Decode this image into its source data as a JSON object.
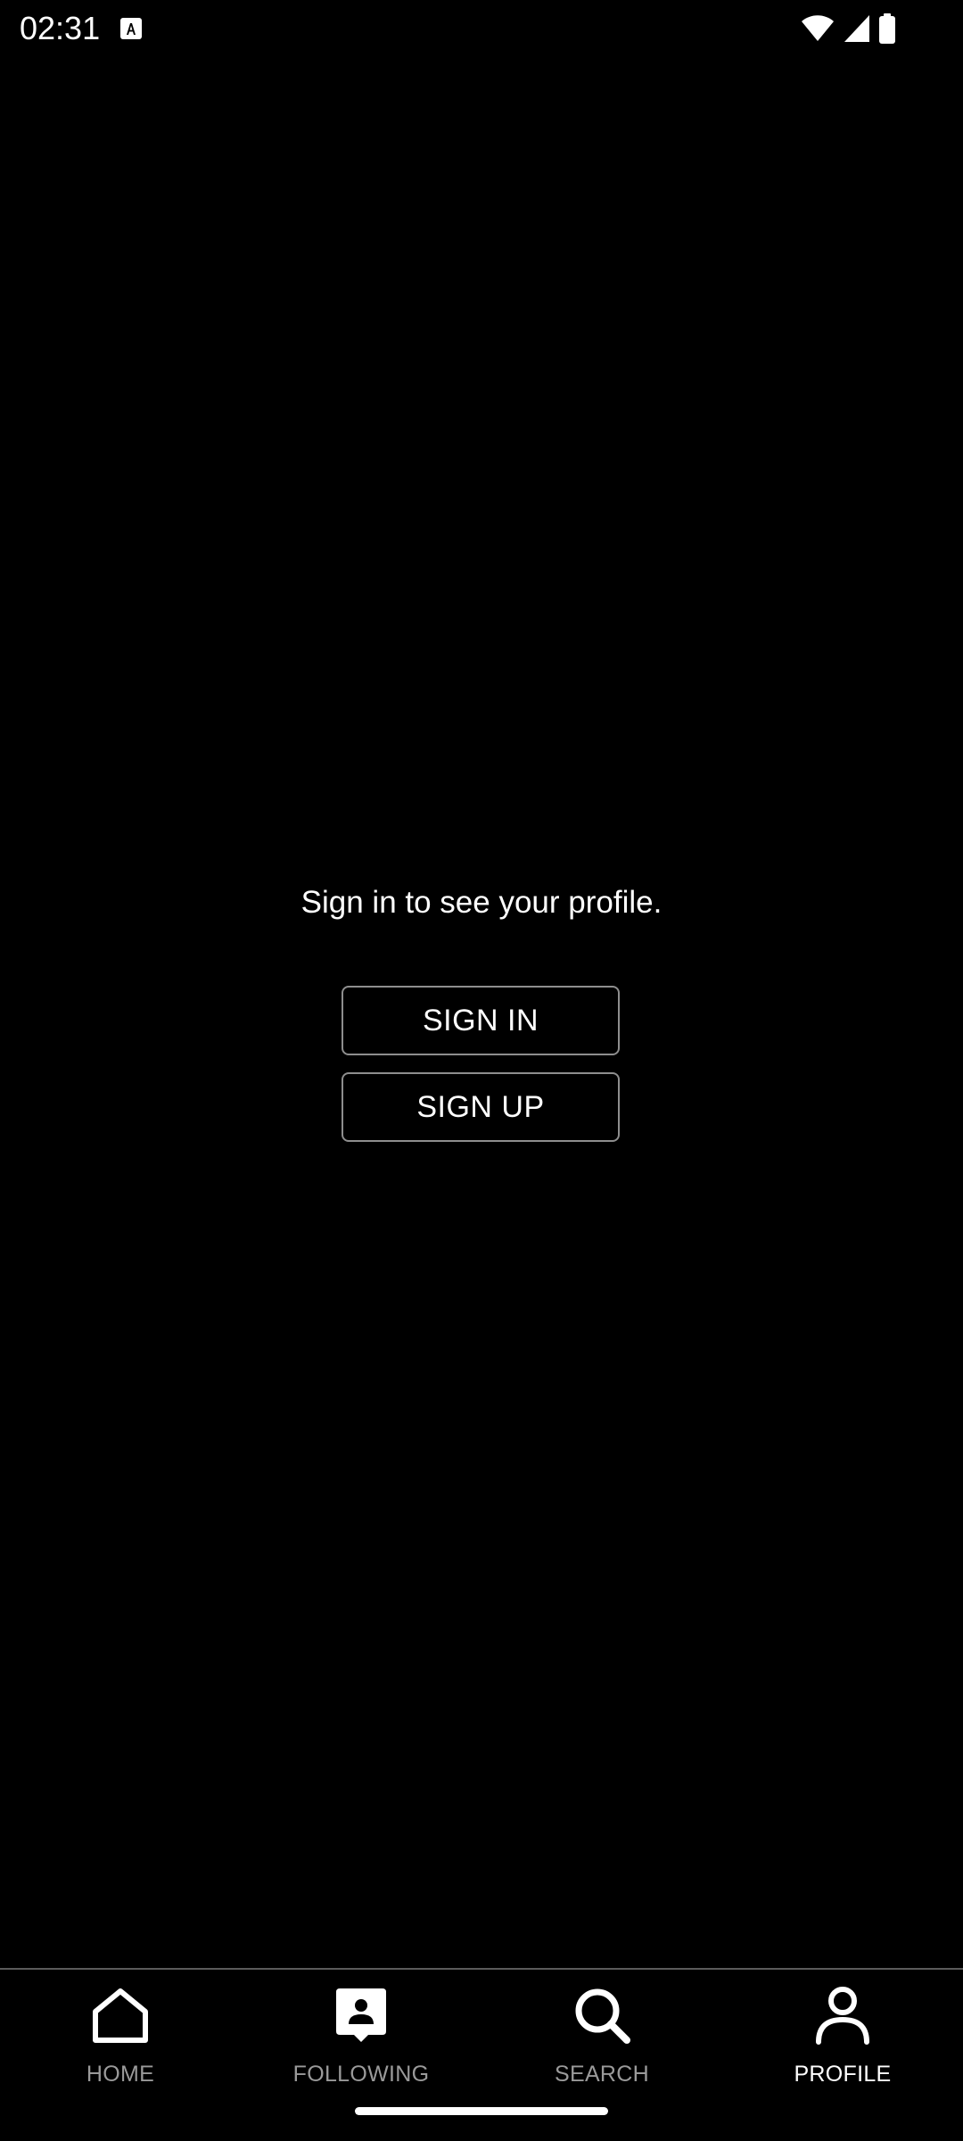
{
  "status_bar": {
    "time": "02:31",
    "icons": [
      "a-notification-icon",
      "wifi-icon",
      "signal-icon",
      "battery-icon"
    ]
  },
  "main": {
    "prompt": "Sign in to see your profile.",
    "sign_in_label": "SIGN IN",
    "sign_up_label": "SIGN UP"
  },
  "bottom_nav": {
    "items": [
      {
        "label": "HOME",
        "icon": "home-icon",
        "active": false
      },
      {
        "label": "FOLLOWING",
        "icon": "following-icon",
        "active": false
      },
      {
        "label": "SEARCH",
        "icon": "search-icon",
        "active": false
      },
      {
        "label": "PROFILE",
        "icon": "profile-icon",
        "active": true
      }
    ]
  },
  "colors": {
    "background": "#000000",
    "text": "#ffffff",
    "inactive_label": "#9a9a9a",
    "button_border": "#8e8e8e"
  }
}
